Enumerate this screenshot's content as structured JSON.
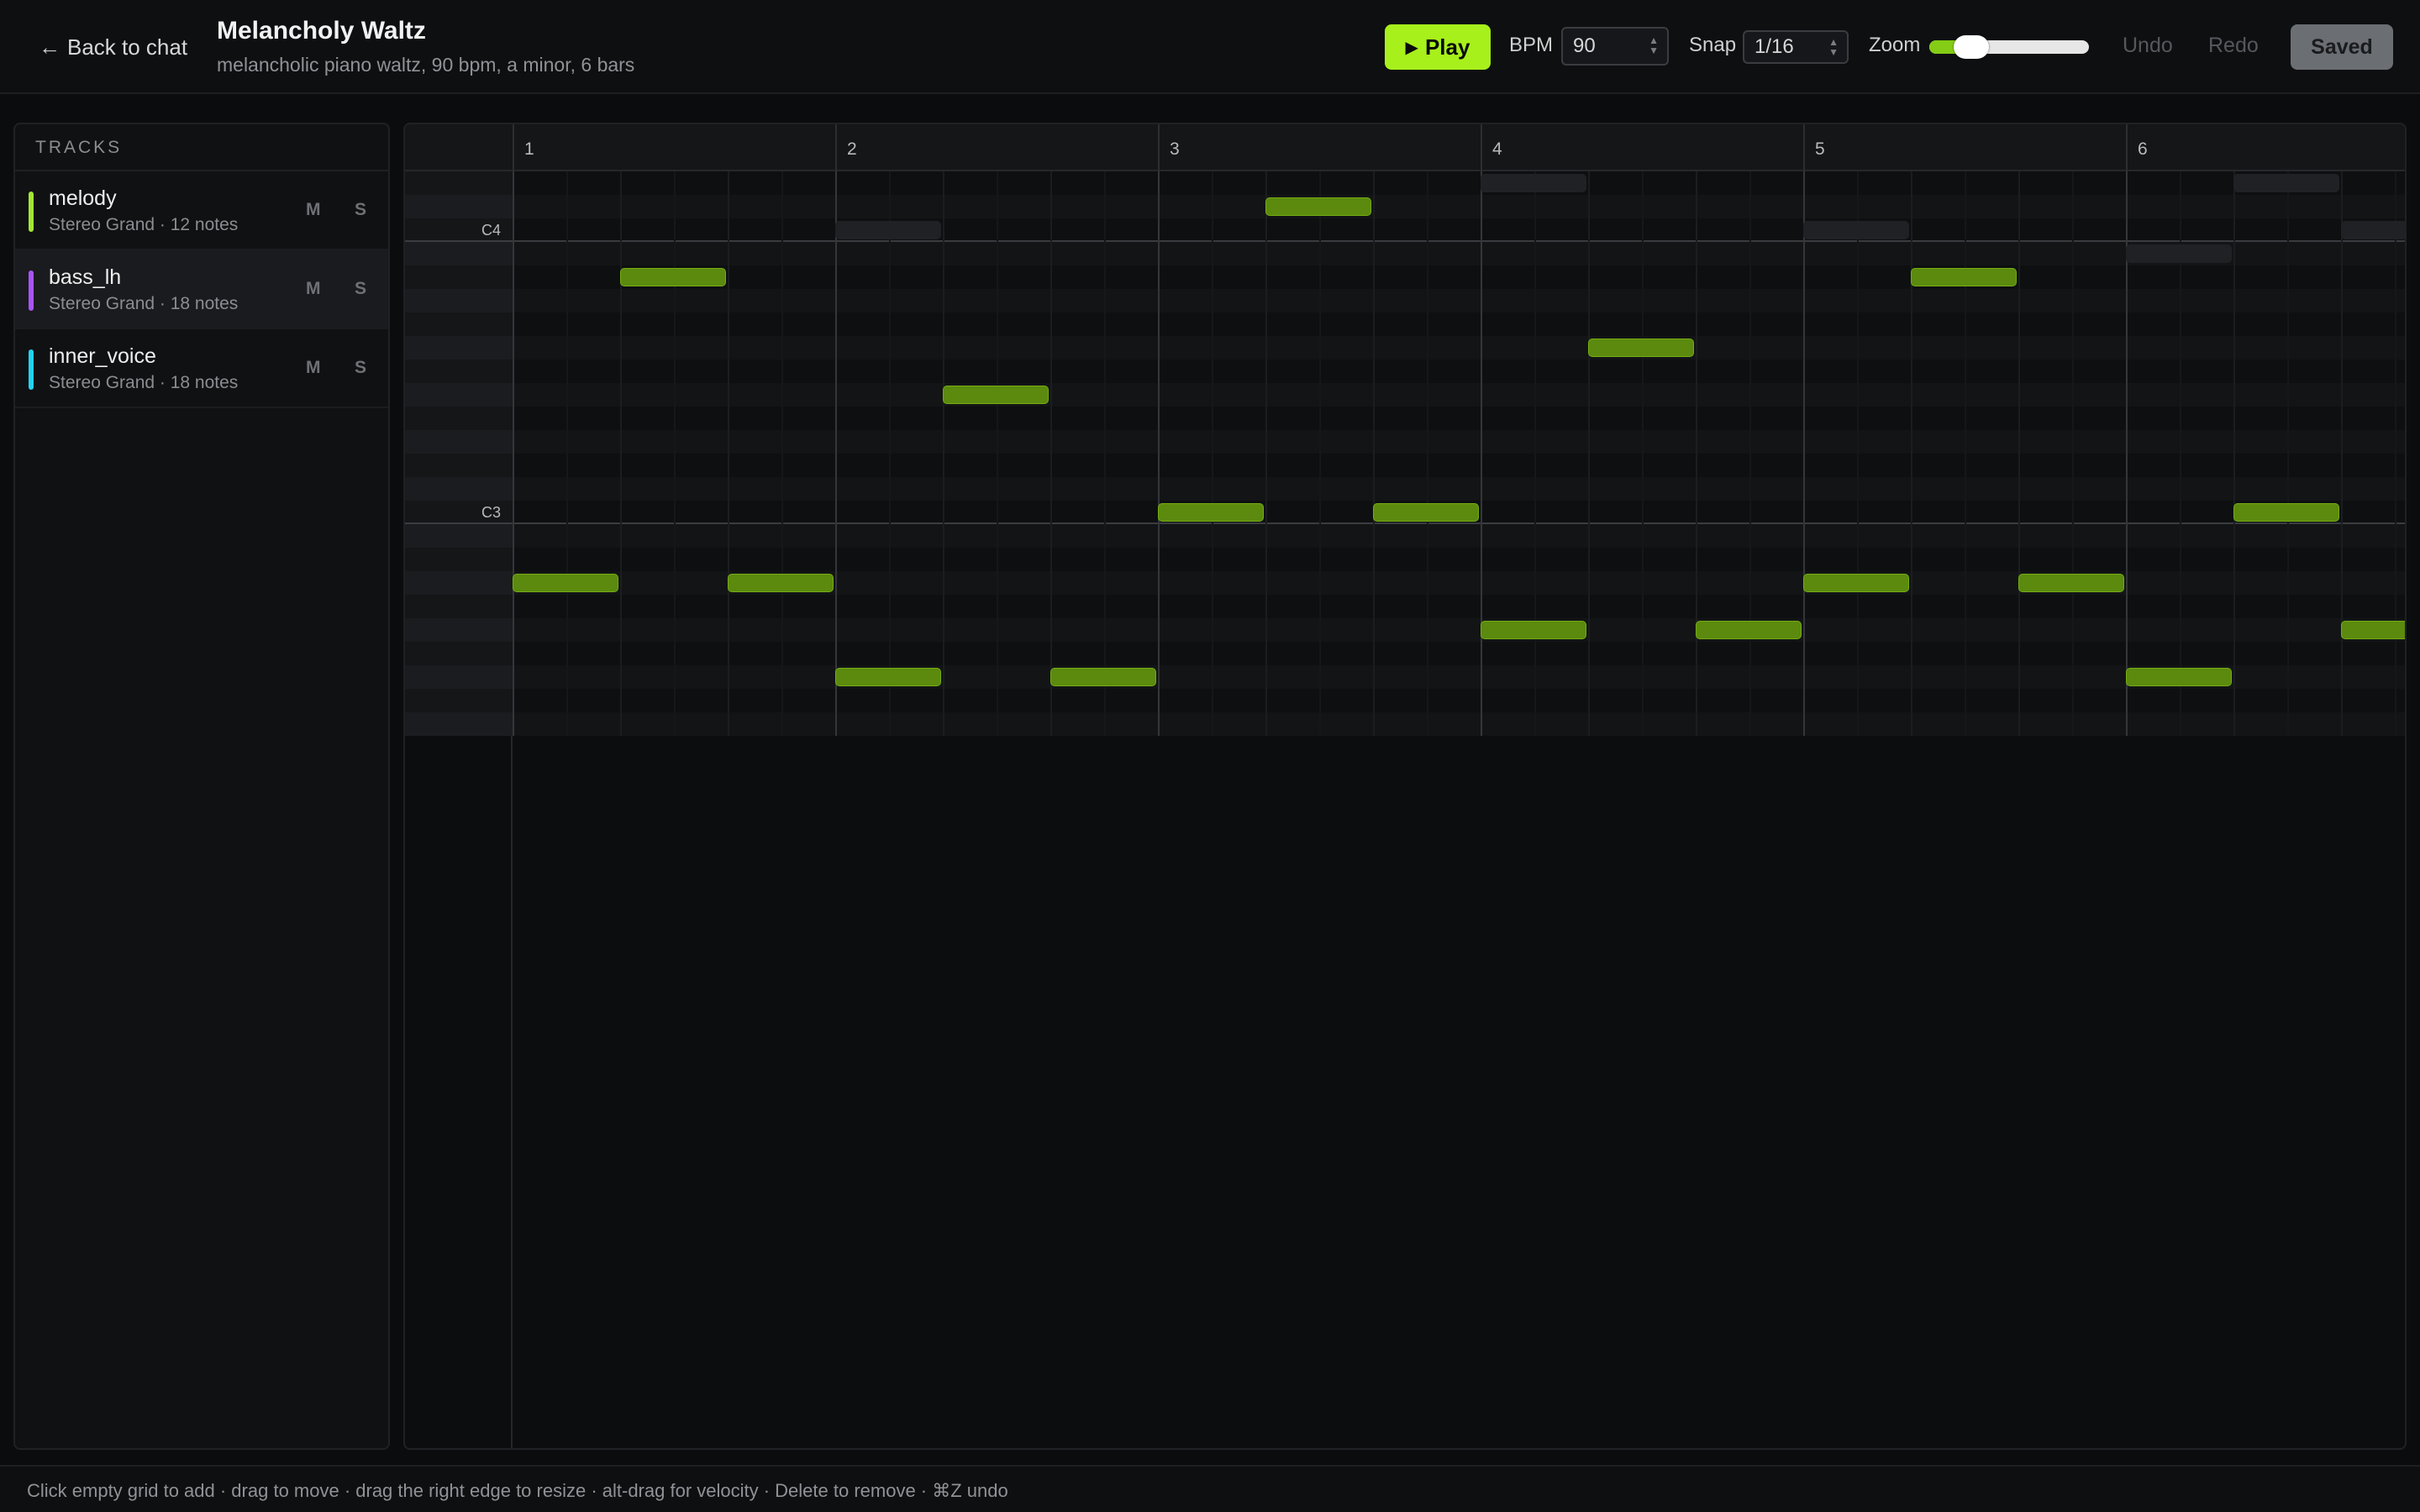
{
  "header": {
    "back_label": "Back to chat",
    "title": "Melancholy Waltz",
    "subtitle": "melancholic piano waltz, 90 bpm, a minor, 6 bars",
    "play_label": "Play",
    "bpm_label": "BPM",
    "bpm_value": "90",
    "snap_label": "Snap",
    "snap_value": "1/16",
    "zoom_label": "Zoom",
    "zoom_level": 0.2,
    "undo_label": "Undo",
    "redo_label": "Redo",
    "saved_label": "Saved"
  },
  "tracks": {
    "heading": "TRACKS",
    "items": [
      {
        "name": "melody",
        "info": "Stereo Grand · 12 notes",
        "color": "#a3e635",
        "mute": "M",
        "solo": "S"
      },
      {
        "name": "bass_lh",
        "info": "Stereo Grand · 18 notes",
        "color": "#a855f7",
        "mute": "M",
        "solo": "S"
      },
      {
        "name": "inner_voice",
        "info": "Stereo Grand · 18 notes",
        "color": "#22d3ee",
        "mute": "M",
        "solo": "S"
      }
    ]
  },
  "roll": {
    "bars": [
      "1",
      "2",
      "3",
      "4",
      "5",
      "6"
    ],
    "key_labels": [
      "C4",
      "C3"
    ],
    "notes": [
      {
        "bar": 1,
        "beat": 1,
        "row": 17
      },
      {
        "bar": 1,
        "beat": 2,
        "row": 4
      },
      {
        "bar": 1,
        "beat": 3,
        "row": 17
      },
      {
        "bar": 2,
        "beat": 1,
        "row": 21
      },
      {
        "bar": 2,
        "beat": 2,
        "row": 9
      },
      {
        "bar": 2,
        "beat": 3,
        "row": 21
      },
      {
        "bar": 3,
        "beat": 1,
        "row": 14
      },
      {
        "bar": 3,
        "beat": 2,
        "row": 1
      },
      {
        "bar": 3,
        "beat": 3,
        "row": 14
      },
      {
        "bar": 4,
        "beat": 1,
        "row": 19
      },
      {
        "bar": 4,
        "beat": 2,
        "row": 7
      },
      {
        "bar": 4,
        "beat": 3,
        "row": 19
      },
      {
        "bar": 5,
        "beat": 1,
        "row": 17
      },
      {
        "bar": 5,
        "beat": 2,
        "row": 4
      },
      {
        "bar": 5,
        "beat": 3,
        "row": 17
      },
      {
        "bar": 6,
        "beat": 1,
        "row": 21
      },
      {
        "bar": 6,
        "beat": 2,
        "row": 14
      },
      {
        "bar": 6,
        "beat": 3,
        "row": 19
      }
    ],
    "ghost_notes": [
      {
        "bar": 2,
        "beat": 1,
        "row": 1
      },
      {
        "bar": 4,
        "beat": 1,
        "row": -1
      },
      {
        "bar": 5,
        "beat": 1,
        "row": 1
      },
      {
        "bar": 6,
        "beat": 1,
        "row": 2
      },
      {
        "bar": 6,
        "beat": 2,
        "row": -1
      },
      {
        "bar": 6,
        "beat": 3,
        "row": 1
      }
    ]
  },
  "status_bar": {
    "hint": "Click empty grid to add · drag to move · drag the right edge to resize · alt-drag for velocity · Delete to remove · ⌘Z undo"
  },
  "colors": {
    "accent": "#a7f01b",
    "note_fill": "#5b8a0e"
  }
}
